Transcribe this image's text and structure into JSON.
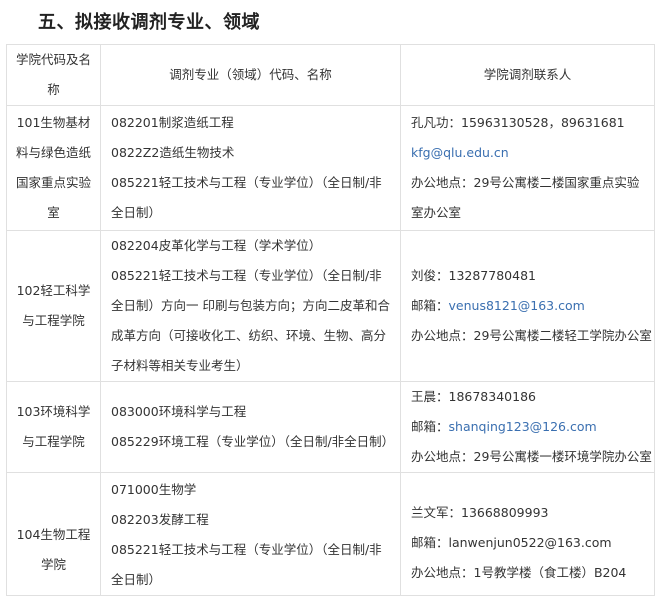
{
  "section": {
    "title": "五、拟接收调剂专业、领域"
  },
  "table": {
    "headers": {
      "college": "学院代码及名称",
      "major": "调剂专业（领域）代码、名称",
      "contact": "学院调剂联系人"
    },
    "rows": [
      {
        "college": "101生物基材料与绿色造纸国家重点实验室",
        "majors": [
          "082201制浆造纸工程",
          "0822Z2造纸生物技术",
          "085221轻工技术与工程（专业学位）（全日制/非全日制）"
        ],
        "contact_person": "孔凡功：15963130528，89631681",
        "email": "kfg@qlu.edu.cn",
        "office": "办公地点：29号公寓楼二楼国家重点实验室办公室"
      },
      {
        "college": "102轻工科学与工程学院",
        "majors": [
          "082204皮革化学与工程（学术学位）",
          "085221轻工技术与工程（专业学位）（全日制/非全日制）方向一 印刷与包装方向；方向二皮革和合成革方向（可接收化工、纺织、环境、生物、高分子材料等相关专业考生）"
        ],
        "contact_person": "刘俊：13287780481",
        "email_label": "邮箱：",
        "email": "venus8121@163.com",
        "office": "办公地点：29号公寓楼二楼轻工学院办公室"
      },
      {
        "college": "103环境科学与工程学院",
        "majors": [
          "083000环境科学与工程",
          "085229环境工程（专业学位）（全日制/非全日制）"
        ],
        "contact_person": "王晨：18678340186",
        "email_label": "邮箱：",
        "email": "shanqing123@126.com",
        "office": "办公地点：29号公寓楼一楼环境学院办公室"
      },
      {
        "college": "104生物工程学院",
        "majors": [
          "071000生物学",
          "082203发酵工程",
          "085221轻工技术与工程（专业学位）（全日制/非全日制）"
        ],
        "contact_person": "兰文军：13668809993",
        "email_line": "邮箱：lanwenjun0522@163.com",
        "office": "办公地点：1号教学楼（食工楼）B204"
      }
    ]
  }
}
